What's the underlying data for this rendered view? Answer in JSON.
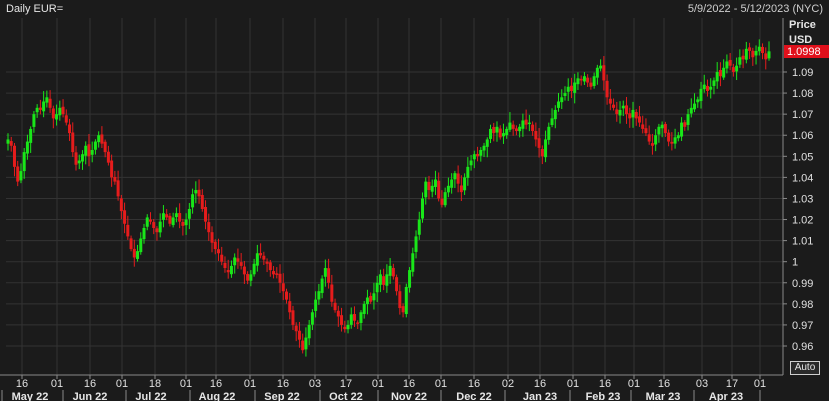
{
  "header": {
    "title": "Daily EUR=",
    "date_range": "5/9/2022 - 5/12/2023 (NYC)"
  },
  "auto_button": "Auto",
  "colors": {
    "up": "#19e619",
    "down": "#e61c1c",
    "background": "#1b1b1b",
    "grid": "#333333",
    "last_price_bg": "#e0101b"
  },
  "chart_data": {
    "type": "candlestick",
    "y_axis": {
      "label": "Price",
      "unit": "USD",
      "ticks": [
        0.96,
        0.97,
        0.98,
        0.99,
        1,
        1.01,
        1.02,
        1.03,
        1.04,
        1.05,
        1.06,
        1.07,
        1.08,
        1.09
      ],
      "tick_labels": [
        "0.96",
        "0.97",
        "0.98",
        "0.99",
        "1",
        "1.01",
        "1.02",
        "1.03",
        "1.04",
        "1.05",
        "1.06",
        "1.07",
        "1.08",
        "1.09"
      ],
      "range": [
        0.955,
        1.1
      ]
    },
    "last_price": "1.0998",
    "x_axis": {
      "day_ticks": [
        "16",
        "01",
        "16",
        "01",
        "18",
        "01",
        "16",
        "01",
        "16",
        "03",
        "17",
        "01",
        "16",
        "01",
        "16",
        "02",
        "16",
        "01",
        "16",
        "01",
        "16",
        "03",
        "17",
        "01"
      ],
      "month_labels": [
        "May 22",
        "Jun 22",
        "Jul 22",
        "Aug 22",
        "Sep 22",
        "Oct 22",
        "Nov 22",
        "Dec 22",
        "Jan 23",
        "Feb 23",
        "Mar 23",
        "Apr 23"
      ]
    },
    "close_path": [
      1.058,
      1.055,
      1.045,
      1.038,
      1.043,
      1.052,
      1.057,
      1.063,
      1.07,
      1.073,
      1.072,
      1.076,
      1.078,
      1.073,
      1.068,
      1.07,
      1.073,
      1.07,
      1.066,
      1.061,
      1.052,
      1.046,
      1.048,
      1.051,
      1.055,
      1.05,
      1.053,
      1.057,
      1.06,
      1.056,
      1.052,
      1.047,
      1.04,
      1.038,
      1.031,
      1.024,
      1.018,
      1.012,
      1.006,
      1.002,
      1.005,
      1.011,
      1.016,
      1.021,
      1.019,
      1.016,
      1.014,
      1.019,
      1.023,
      1.021,
      1.018,
      1.021,
      1.023,
      1.019,
      1.017,
      1.02,
      1.025,
      1.032,
      1.034,
      1.031,
      1.025,
      1.019,
      1.014,
      1.009,
      1.006,
      1.004,
      1.0,
      0.997,
      0.995,
      0.998,
      1.002,
      1.0,
      0.998,
      0.994,
      0.991,
      0.994,
      0.999,
      1.004,
      1.003,
      1.001,
      0.999,
      0.996,
      0.994,
      0.994,
      0.99,
      0.986,
      0.982,
      0.976,
      0.97,
      0.967,
      0.963,
      0.958,
      0.964,
      0.97,
      0.976,
      0.982,
      0.986,
      0.992,
      0.997,
      0.99,
      0.981,
      0.977,
      0.974,
      0.97,
      0.968,
      0.97,
      0.975,
      0.972,
      0.971,
      0.976,
      0.98,
      0.983,
      0.981,
      0.985,
      0.99,
      0.994,
      0.989,
      0.994,
      0.998,
      0.993,
      0.986,
      0.978,
      0.976,
      0.988,
      0.996,
      1.004,
      1.012,
      1.02,
      1.03,
      1.038,
      1.034,
      1.036,
      1.039,
      1.03,
      1.027,
      1.033,
      1.036,
      1.039,
      1.042,
      1.037,
      1.033,
      1.04,
      1.045,
      1.048,
      1.051,
      1.05,
      1.053,
      1.055,
      1.058,
      1.063,
      1.061,
      1.064,
      1.059,
      1.061,
      1.063,
      1.066,
      1.063,
      1.062,
      1.064,
      1.067,
      1.065,
      1.066,
      1.062,
      1.058,
      1.054,
      1.05,
      1.058,
      1.064,
      1.068,
      1.072,
      1.076,
      1.078,
      1.08,
      1.083,
      1.081,
      1.085,
      1.087,
      1.086,
      1.088,
      1.085,
      1.083,
      1.088,
      1.092,
      1.093,
      1.086,
      1.078,
      1.075,
      1.073,
      1.07,
      1.072,
      1.074,
      1.07,
      1.068,
      1.072,
      1.068,
      1.066,
      1.063,
      1.061,
      1.057,
      1.055,
      1.06,
      1.064,
      1.065,
      1.061,
      1.057,
      1.056,
      1.059,
      1.06,
      1.066,
      1.064,
      1.07,
      1.073,
      1.075,
      1.077,
      1.082,
      1.084,
      1.081,
      1.083,
      1.086,
      1.09,
      1.088,
      1.092,
      1.095,
      1.093,
      1.09,
      1.093,
      1.097,
      1.096,
      1.101,
      1.1,
      1.097,
      1.1,
      1.102,
      1.099,
      1.096,
      1.0998
    ]
  }
}
